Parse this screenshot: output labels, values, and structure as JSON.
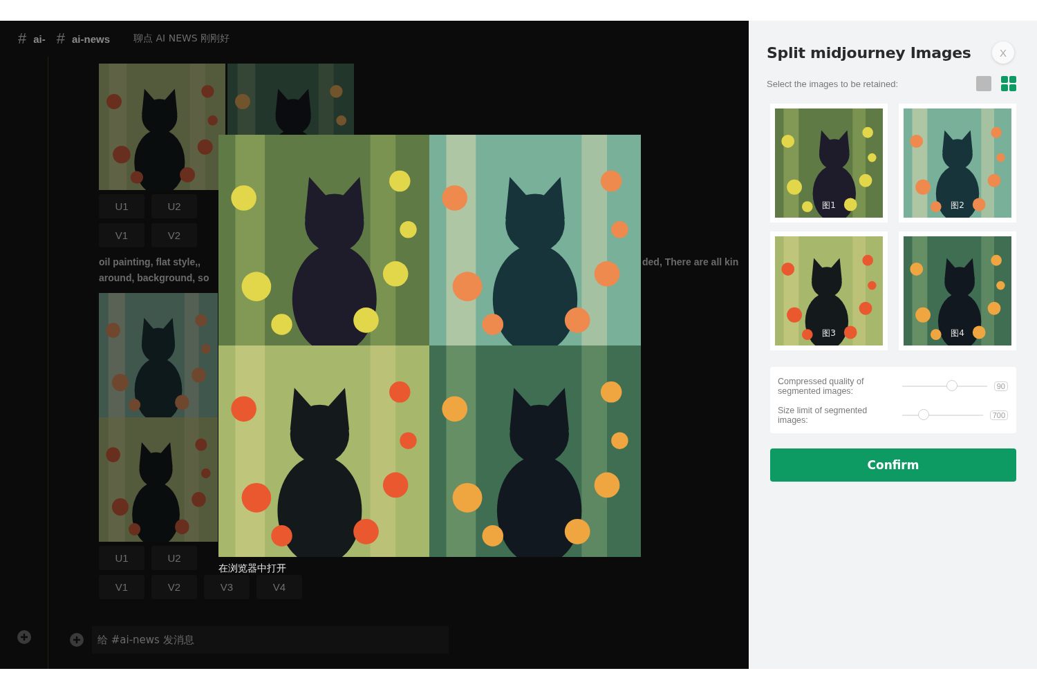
{
  "channel_header": {
    "channels": [
      {
        "icon": "#",
        "name": "ai-"
      },
      {
        "icon": "#",
        "name": "ai-news"
      }
    ],
    "topic": "聊点 AI NEWS 刚刚好"
  },
  "messages": [
    {
      "button_rows": [
        [
          "U1",
          "U2"
        ],
        [
          "V1",
          "V2"
        ]
      ],
      "prompt_lines": [
        "oil painting, flat style,,",
        "around, background, so"
      ],
      "prompt_tail": "ded, There are all kin"
    },
    {
      "button_rows": [
        [
          "U1",
          "U2"
        ],
        [
          "V1",
          "V2",
          "V3",
          "V4"
        ]
      ]
    }
  ],
  "composer": {
    "placeholder": "给 #ai-news 发消息"
  },
  "lightbox": {
    "caption": "在浏览器中打开"
  },
  "panel": {
    "title": "Split midjourney Images",
    "close": "X",
    "instruction": "Select the images to be retained:",
    "view_modes": [
      {
        "kind": "single",
        "selected": false
      },
      {
        "kind": "grid",
        "selected": true
      }
    ],
    "images": [
      {
        "label": "图1"
      },
      {
        "label": "图2"
      },
      {
        "label": "图3"
      },
      {
        "label": "图4"
      }
    ],
    "settings": [
      {
        "label": "Compressed quality of segmented images:",
        "level": 0.59,
        "value": "90"
      },
      {
        "label": "Size limit of segmented images:",
        "level": 0.27,
        "value": "700"
      }
    ],
    "confirm": "Confirm"
  }
}
